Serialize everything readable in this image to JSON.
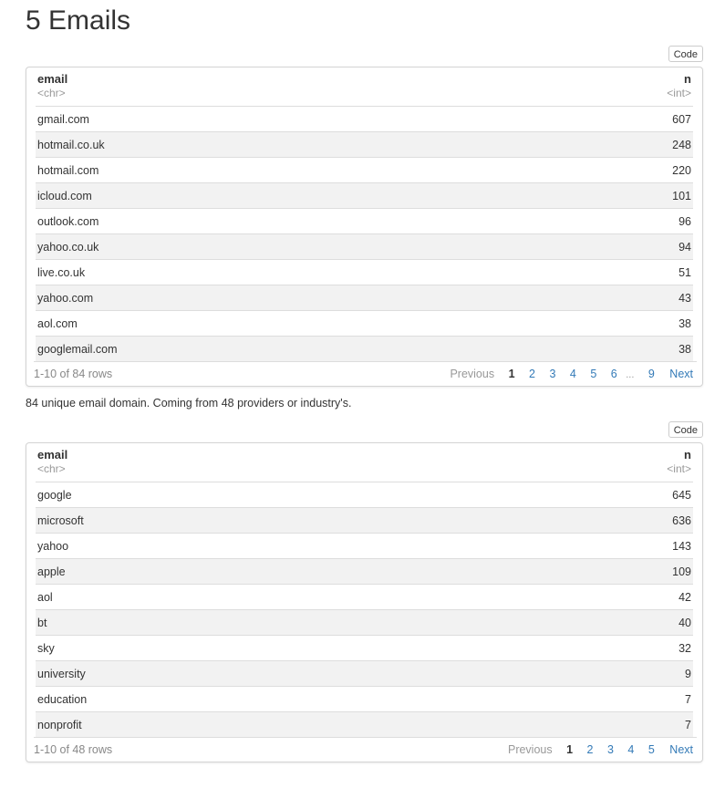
{
  "heading": "5 Emails",
  "code_label": "Code",
  "table1": {
    "columns": {
      "name1": "email",
      "type1": "<chr>",
      "name2": "n",
      "type2": "<int>"
    },
    "rows": [
      {
        "email": "gmail.com",
        "n": "607"
      },
      {
        "email": "hotmail.co.uk",
        "n": "248"
      },
      {
        "email": "hotmail.com",
        "n": "220"
      },
      {
        "email": "icloud.com",
        "n": "101"
      },
      {
        "email": "outlook.com",
        "n": "96"
      },
      {
        "email": "yahoo.co.uk",
        "n": "94"
      },
      {
        "email": "live.co.uk",
        "n": "51"
      },
      {
        "email": "yahoo.com",
        "n": "43"
      },
      {
        "email": "aol.com",
        "n": "38"
      },
      {
        "email": "googlemail.com",
        "n": "38"
      }
    ],
    "info": "1-10 of 84 rows",
    "pager": {
      "previous": "Previous",
      "current": "1",
      "pages": [
        "2",
        "3",
        "4",
        "5",
        "6"
      ],
      "ellipsis": "...",
      "last": "9",
      "next": "Next"
    }
  },
  "note": "84 unique email domain. Coming from 48 providers or industry's.",
  "table2": {
    "columns": {
      "name1": "email",
      "type1": "<chr>",
      "name2": "n",
      "type2": "<int>"
    },
    "rows": [
      {
        "email": "google",
        "n": "645"
      },
      {
        "email": "microsoft",
        "n": "636"
      },
      {
        "email": "yahoo",
        "n": "143"
      },
      {
        "email": "apple",
        "n": "109"
      },
      {
        "email": "aol",
        "n": "42"
      },
      {
        "email": "bt",
        "n": "40"
      },
      {
        "email": "sky",
        "n": "32"
      },
      {
        "email": "university",
        "n": "9"
      },
      {
        "email": "education",
        "n": "7"
      },
      {
        "email": "nonprofit",
        "n": "7"
      }
    ],
    "info": "1-10 of 48 rows",
    "pager": {
      "previous": "Previous",
      "current": "1",
      "pages": [
        "2",
        "3",
        "4",
        "5"
      ],
      "next": "Next"
    }
  }
}
